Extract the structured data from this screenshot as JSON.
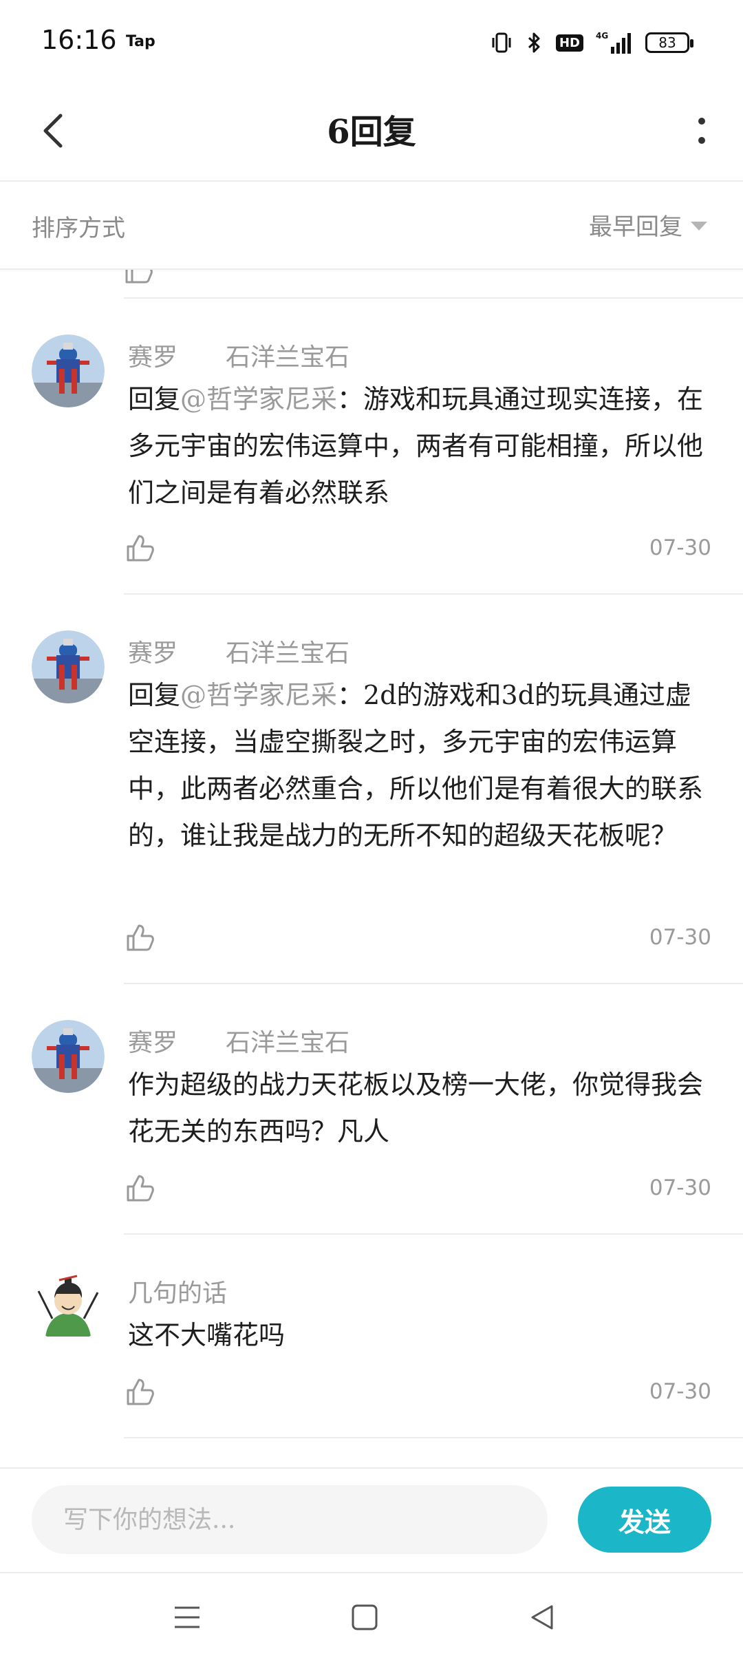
{
  "status_bar": {
    "time": "16:16",
    "app_indicator": "Tap",
    "icons": [
      "vibrate-icon",
      "bluetooth-icon",
      "hd-icon",
      "signal-4g-icon",
      "battery-icon"
    ],
    "hd_label": "HD",
    "network_label": "4G",
    "battery_level": "83"
  },
  "header": {
    "title": "6回复",
    "back_icon": "chevron-left-icon",
    "more_icon": "more-vertical-icon"
  },
  "sort_bar": {
    "label": "排序方式",
    "selected": "最早回复"
  },
  "replies": [
    {
      "username": "赛罗",
      "badge": "石洋兰宝石",
      "reply_prefix": "回复",
      "mention": "@哲学家尼采",
      "text": "：游戏和玩具通过现实连接，在多元宇宙的宏伟运算中，两者有可能相撞，所以他们之间是有着必然联系",
      "date": "07-30"
    },
    {
      "username": "赛罗",
      "badge": "石洋兰宝石",
      "reply_prefix": "回复",
      "mention": "@哲学家尼采",
      "text": "：2d的游戏和3d的玩具通过虚空连接，当虚空撕裂之时，多元宇宙的宏伟运算中，此两者必然重合，所以他们是有着很大的联系的，谁让我是战力的无所不知的超级天花板呢？",
      "date": "07-30"
    },
    {
      "username": "赛罗",
      "badge": "石洋兰宝石",
      "text": "作为超级的战力天花板以及榜一大佬，你觉得我会花无关的东西吗？凡人",
      "date": "07-30"
    },
    {
      "username": "几句的话",
      "text": "这不大嘴花吗",
      "date": "07-30"
    }
  ],
  "composer": {
    "placeholder": "写下你的想法...",
    "send_label": "发送"
  },
  "colors": {
    "accent": "#1bb6c8",
    "muted_text": "#9a9a9a",
    "divider": "#ececec"
  },
  "nav_bar": {
    "icons": [
      "menu-icon",
      "home-square-icon",
      "back-triangle-icon"
    ]
  }
}
